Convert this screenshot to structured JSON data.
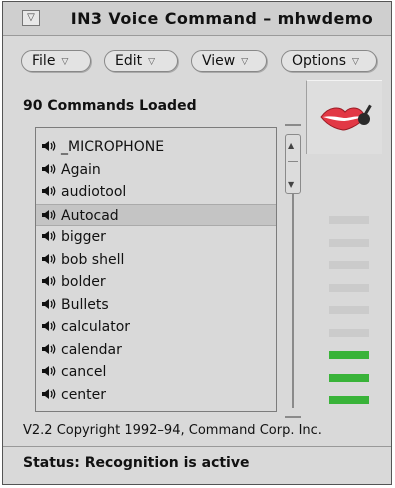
{
  "window": {
    "title": "IN3 Voice Command – mhwdemo"
  },
  "menubar": {
    "items": [
      {
        "label": "File"
      },
      {
        "label": "Edit"
      },
      {
        "label": "View"
      },
      {
        "label": "Options"
      }
    ]
  },
  "commands": {
    "loaded_label": "90 Commands Loaded",
    "items": [
      {
        "label": "_MICROPHONE"
      },
      {
        "label": "Again"
      },
      {
        "label": "audiotool"
      },
      {
        "label": "Autocad"
      },
      {
        "label": "bigger"
      },
      {
        "label": "bob shell"
      },
      {
        "label": "bolder"
      },
      {
        "label": "Bullets"
      },
      {
        "label": "calculator"
      },
      {
        "label": "calendar"
      },
      {
        "label": "cancel"
      },
      {
        "label": "center"
      }
    ],
    "selected_label": "Autocad"
  },
  "level_meter": {
    "segments": [
      {
        "state": "off"
      },
      {
        "state": "off"
      },
      {
        "state": "off"
      },
      {
        "state": "off"
      },
      {
        "state": "off"
      },
      {
        "state": "off"
      },
      {
        "state": "on"
      },
      {
        "state": "on"
      },
      {
        "state": "on"
      }
    ],
    "on_color": "#39b339",
    "off_color": "#cbcbcb"
  },
  "icons": {
    "mic": "lips-microphone-icon",
    "speaker": "speaker-icon",
    "window_menu": "window-menu-icon"
  },
  "footer": {
    "copyright": "V2.2 Copyright 1992–94, Command Corp. Inc.",
    "status": "Status: Recognition is active"
  }
}
